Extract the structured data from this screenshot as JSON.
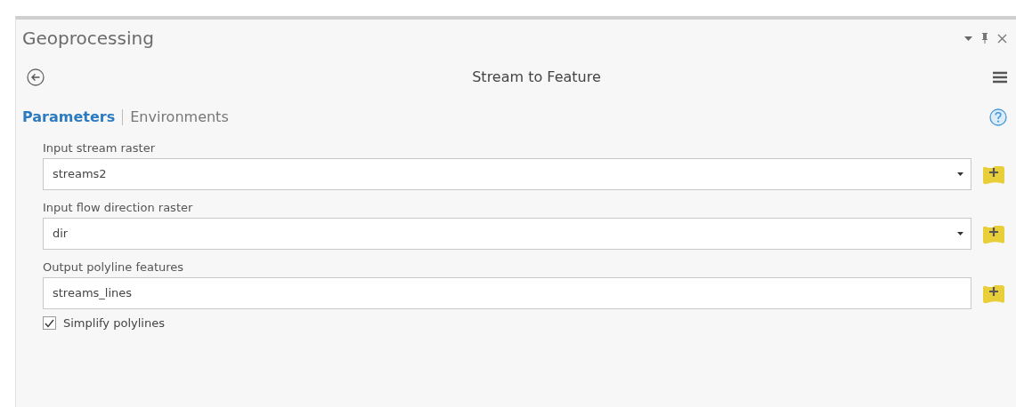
{
  "pane": {
    "title": "Geoprocessing"
  },
  "tool": {
    "title": "Stream to Feature"
  },
  "tabs": [
    {
      "label": "Parameters",
      "selected": true
    },
    {
      "label": "Environments",
      "selected": false
    }
  ],
  "parameters": [
    {
      "kind": "dropdown",
      "label": "Input stream raster",
      "value": "streams2"
    },
    {
      "kind": "dropdown",
      "label": "Input flow direction raster",
      "value": "dir"
    },
    {
      "kind": "text",
      "label": "Output polyline features",
      "value": "streams_lines"
    }
  ],
  "options": [
    {
      "label": "Simplify polylines",
      "checked": true
    }
  ]
}
